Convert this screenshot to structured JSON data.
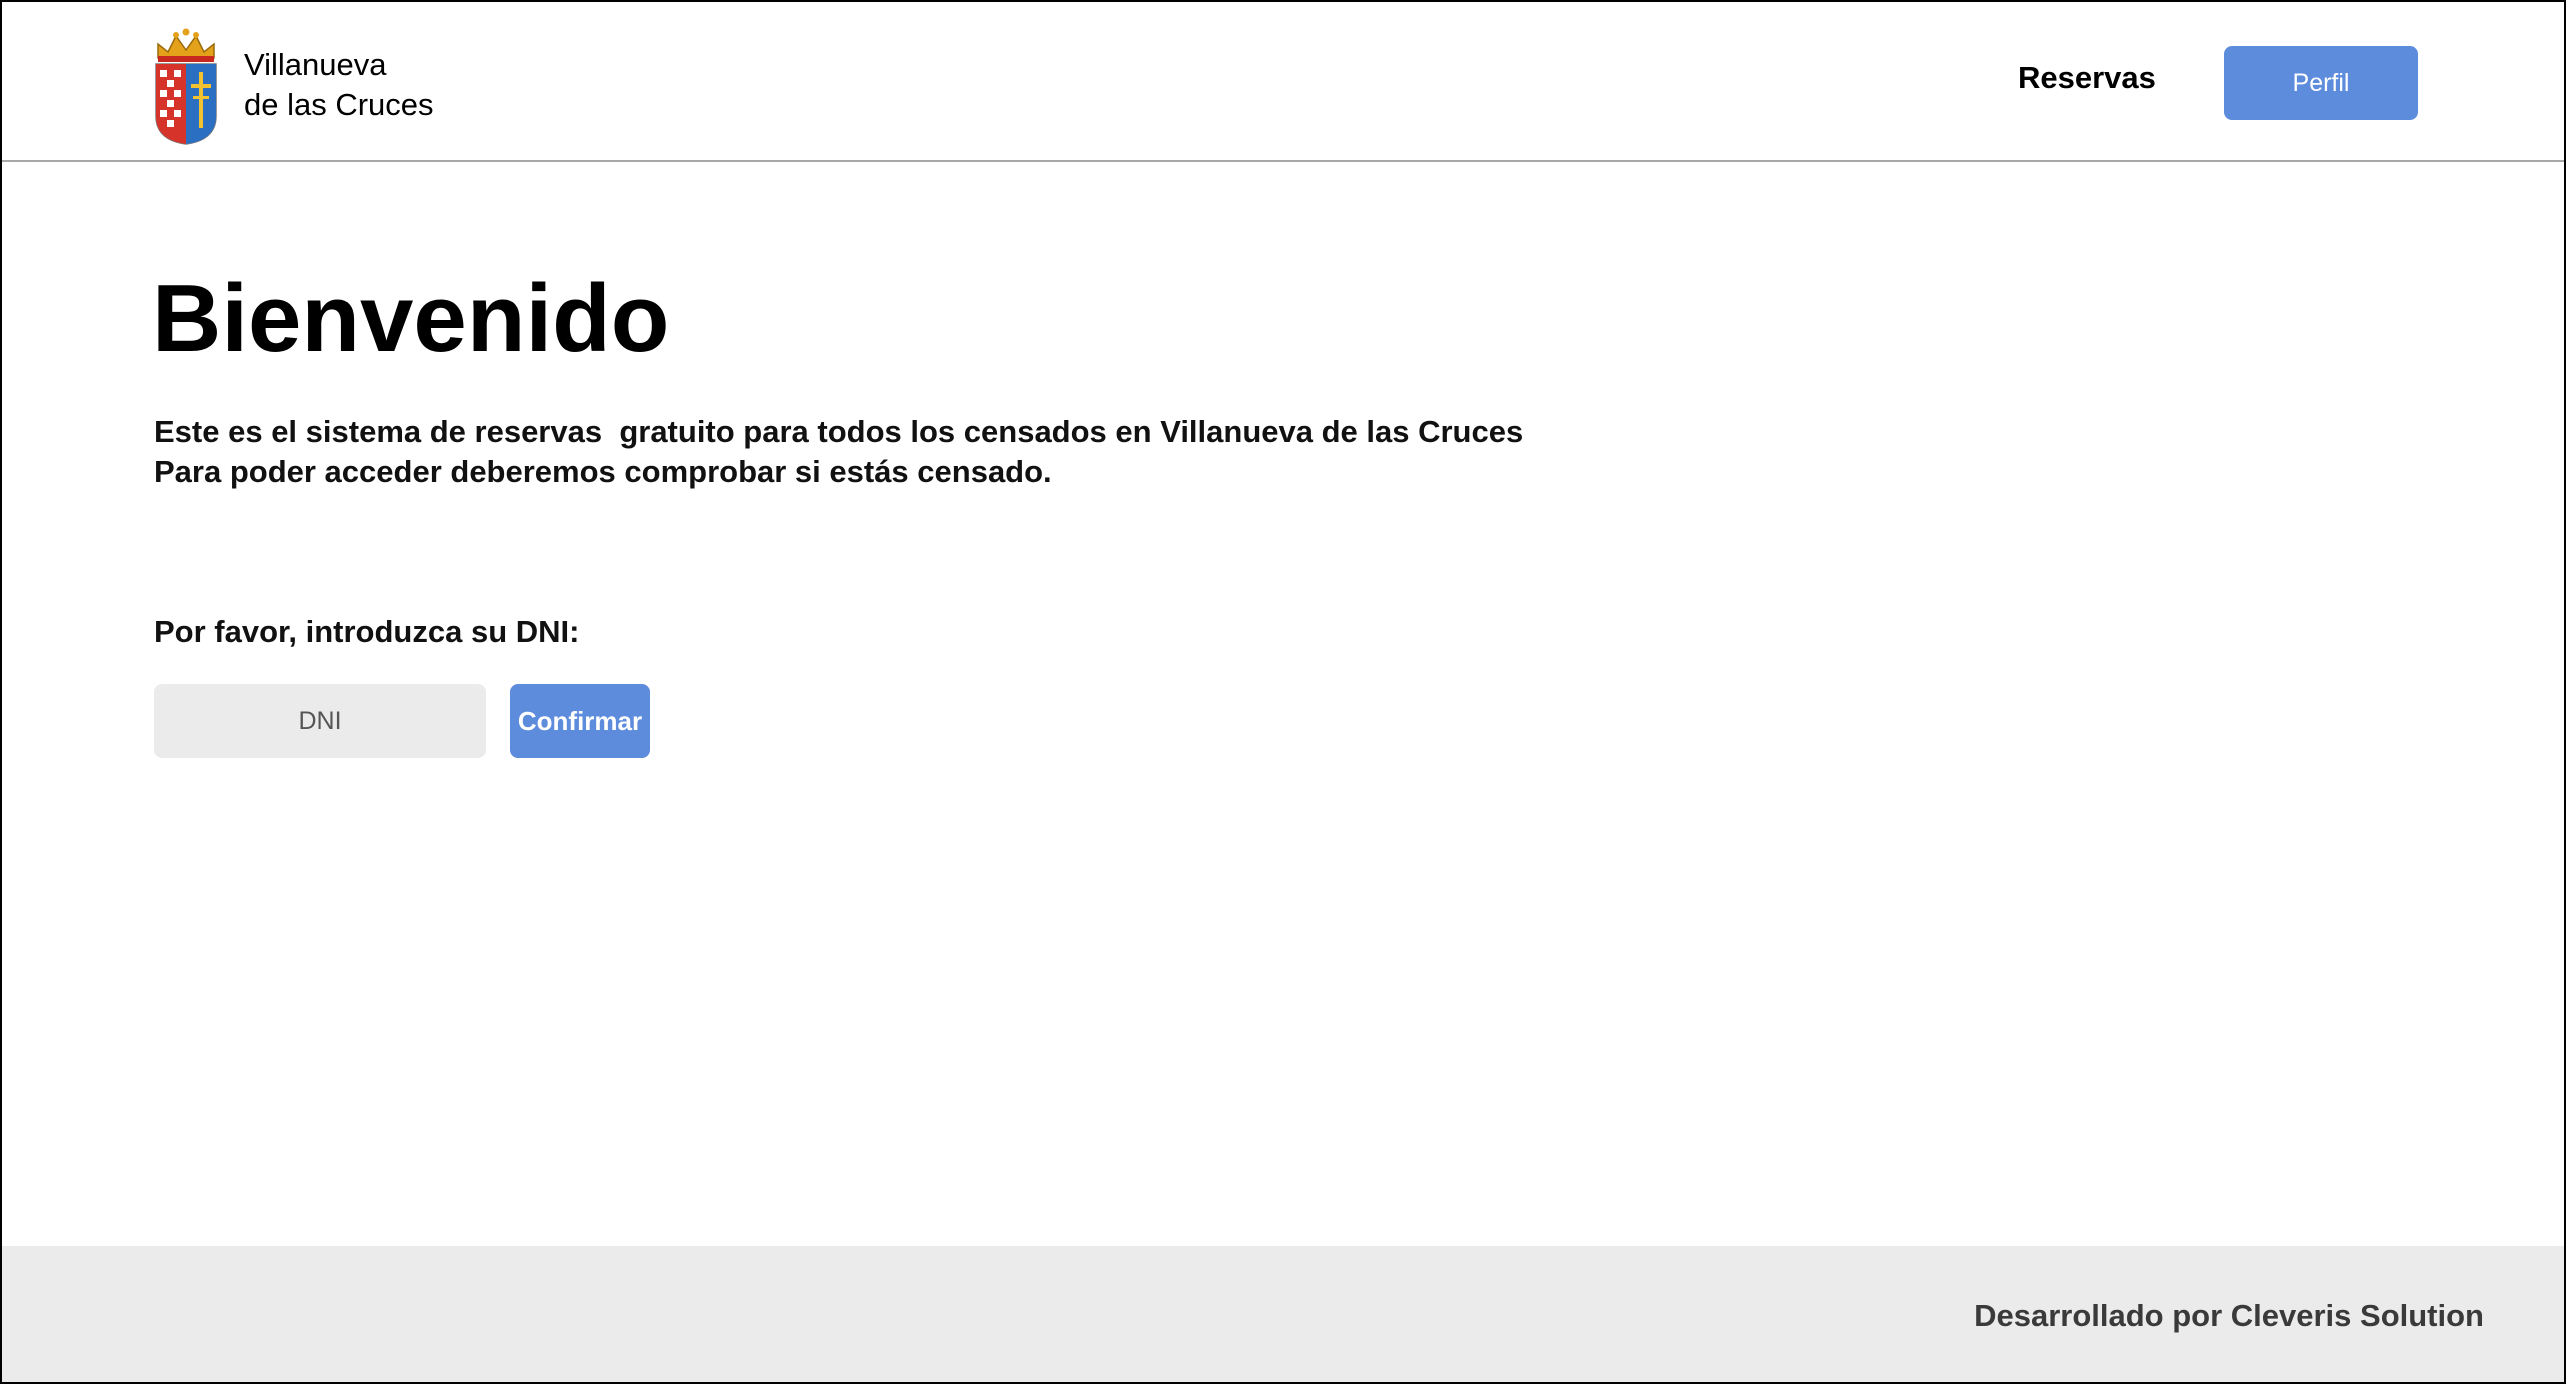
{
  "header": {
    "brand": {
      "line1": "Villanueva",
      "line2": "de las Cruces",
      "logo_icon": "coat-of-arms-icon"
    },
    "nav": {
      "reservas_label": "Reservas",
      "perfil_label": "Perfil"
    }
  },
  "main": {
    "title": "Bienvenido",
    "intro_line1": "Este es el sistema de reservas  gratuito para todos los censados en Villanueva de las Cruces",
    "intro_line2": "Para poder acceder deberemos comprobar si estás censado.",
    "dni_prompt": "Por favor, introduzca su DNI:",
    "dni_input": {
      "placeholder": "DNI",
      "value": ""
    },
    "confirm_label": "Confirmar"
  },
  "footer": {
    "credit": "Desarrollado por Cleveris Solution"
  },
  "colors": {
    "accent": "#5d8cdc",
    "input_bg": "#ebebeb",
    "footer_bg": "#ebebeb",
    "header_border": "#a8a8a8"
  }
}
